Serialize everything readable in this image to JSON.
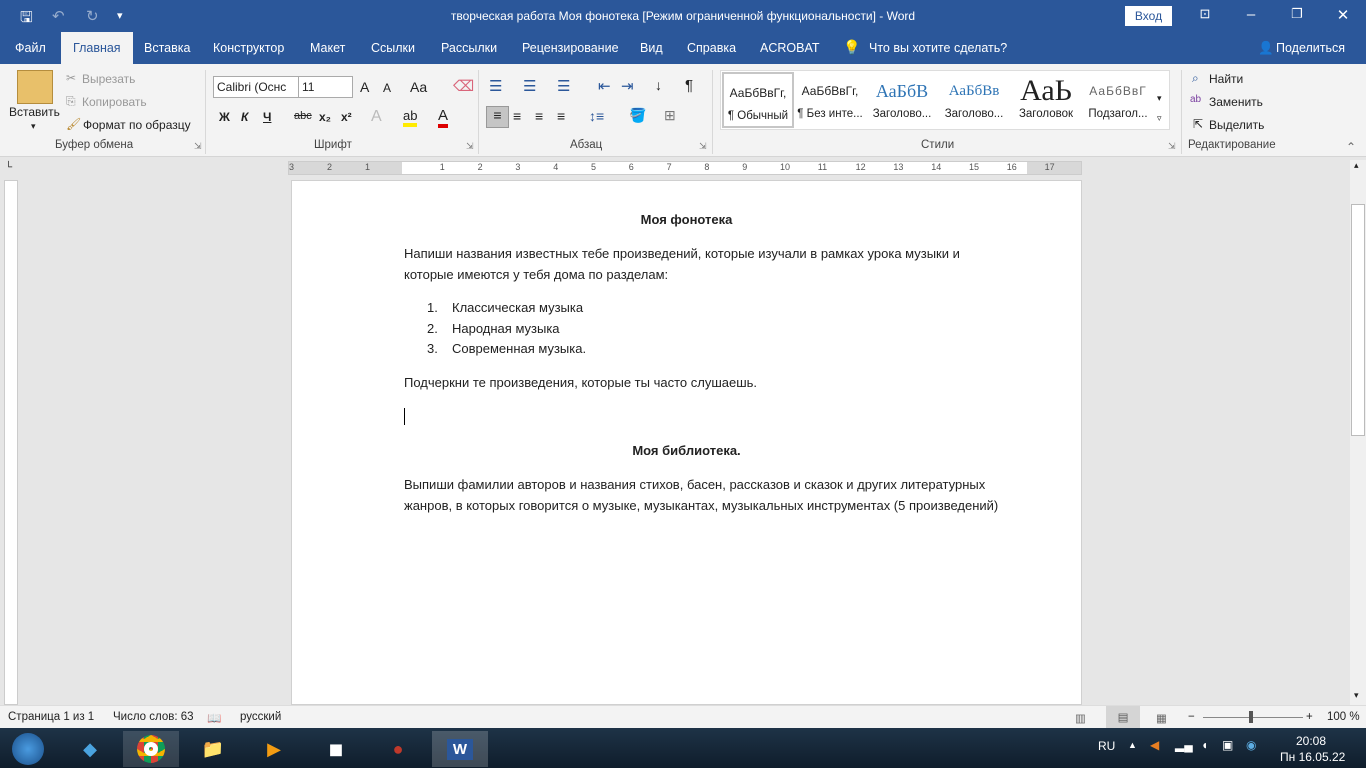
{
  "window": {
    "title": "творческая работа Моя фонотека [Режим ограниченной функциональности]  -  Word",
    "login": "Вход"
  },
  "tabs": [
    "Файл",
    "Главная",
    "Вставка",
    "Конструктор",
    "Макет",
    "Ссылки",
    "Рассылки",
    "Рецензирование",
    "Вид",
    "Справка",
    "ACROBAT"
  ],
  "tell_me": "Что вы хотите сделать?",
  "share": "Поделиться",
  "clipboard": {
    "paste": "Вставить",
    "cut": "Вырезать",
    "copy": "Копировать",
    "format_painter": "Формат по образцу",
    "group": "Буфер обмена"
  },
  "font": {
    "name": "Calibri (Оснс",
    "size": "11",
    "bold": "Ж",
    "italic": "К",
    "underline": "Ч",
    "strike": "abc",
    "sub": "x₂",
    "sup": "x²",
    "grow": "A",
    "shrink": "A",
    "case": "Aa",
    "group": "Шрифт"
  },
  "paragraph": {
    "group": "Абзац"
  },
  "styles": {
    "group": "Стили",
    "items": [
      {
        "preview": "АаБбВвГг,",
        "name": "¶ Обычный"
      },
      {
        "preview": "АаБбВвГг,",
        "name": "¶ Без инте..."
      },
      {
        "preview": "АаБбВ",
        "name": "Заголово..."
      },
      {
        "preview": "АаБбВв",
        "name": "Заголово..."
      },
      {
        "preview": "АаЬ",
        "name": "Заголовок"
      },
      {
        "preview": "АаБбВвГ",
        "name": "Подзагол..."
      }
    ]
  },
  "editing": {
    "find": "Найти",
    "replace": "Заменить",
    "select": "Выделить",
    "group": "Редактирование"
  },
  "ruler": [
    "3",
    "2",
    "1",
    "1",
    "2",
    "3",
    "4",
    "5",
    "6",
    "7",
    "8",
    "9",
    "10",
    "11",
    "12",
    "13",
    "14",
    "15",
    "16",
    "17"
  ],
  "document": {
    "title1": "Моя фонотека",
    "para1_l1": "Напиши названия известных тебе произведений, которые изучали в рамках урока музыки и",
    "para1_l2": "которые имеются у тебя дома по разделам:",
    "list": [
      {
        "num": "1.",
        "text": "Классическая музыка"
      },
      {
        "num": "2.",
        "text": "Народная музыка"
      },
      {
        "num": "3.",
        "text": "Современная музыка."
      }
    ],
    "para2": "Подчеркни те произведения, которые ты  часто слушаешь.",
    "title2": "Моя библиотека.",
    "para3_l1": "Выпиши фамилии авторов и названия стихов, басен, рассказов и сказок и других литературных",
    "para3_l2": "жанров, в которых говорится о музыке, музыкантах, музыкальных инструментах (5 произведений)"
  },
  "status": {
    "page": "Страница 1 из 1",
    "words": "Число слов: 63",
    "lang": "русский",
    "zoom": "100 %",
    "zoom_percent": 100
  },
  "tray": {
    "lang": "RU",
    "time": "20:08",
    "date": "Пн 16.05.22"
  }
}
